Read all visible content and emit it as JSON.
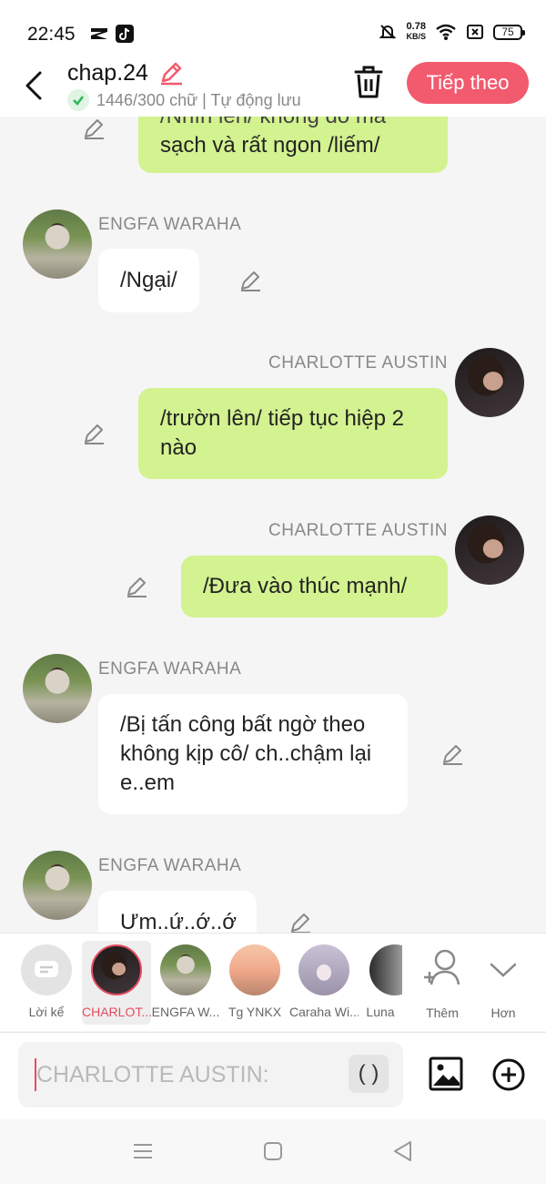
{
  "status": {
    "time": "22:45",
    "speed_value": "0.78",
    "speed_unit": "KB/S",
    "battery": "75"
  },
  "header": {
    "title": "chap.24",
    "subtitle": "1446/300 chữ | Tự động lưu",
    "next_label": "Tiếp theo"
  },
  "colors": {
    "accent": "#f25a6e",
    "green_bubble": "#d3f290",
    "selected": "#e64c5e"
  },
  "messages": [
    {
      "speaker": "",
      "side": "right",
      "text_partial": "/Nhìn lên/ không do mà",
      "text": "sạch và rất ngon /liếm/"
    },
    {
      "speaker": "ENGFA WARAHA",
      "side": "left",
      "text": "/Ngại/"
    },
    {
      "speaker": "CHARLOTTE AUSTIN",
      "side": "right",
      "text": "/trườn lên/ tiếp tục hiệp 2 nào"
    },
    {
      "speaker": "CHARLOTTE AUSTIN",
      "side": "right",
      "text": "/Đưa vào thúc mạnh/"
    },
    {
      "speaker": "ENGFA WARAHA",
      "side": "left",
      "text": "/Bị tấn công bất ngờ theo không kịp cô/ ch..chậm lại e..em"
    },
    {
      "speaker": "ENGFA WARAHA",
      "side": "left",
      "text": "Ưm..ứ..ớ..ớ"
    }
  ],
  "characters": [
    {
      "label": "Lời kể",
      "icon": "narrator-icon"
    },
    {
      "label": "CHARLOT...",
      "selected": true
    },
    {
      "label": "ENGFA W..."
    },
    {
      "label": "Tg YNKX"
    },
    {
      "label": "Caraha Wi..."
    },
    {
      "label": "Luna"
    },
    {
      "label": "Thêm",
      "icon": "add-person-icon"
    },
    {
      "label": "Hơn",
      "icon": "chevron-down-icon"
    }
  ],
  "input": {
    "placeholder": "CHARLOTTE AUSTIN:",
    "paren_label": "( )"
  }
}
